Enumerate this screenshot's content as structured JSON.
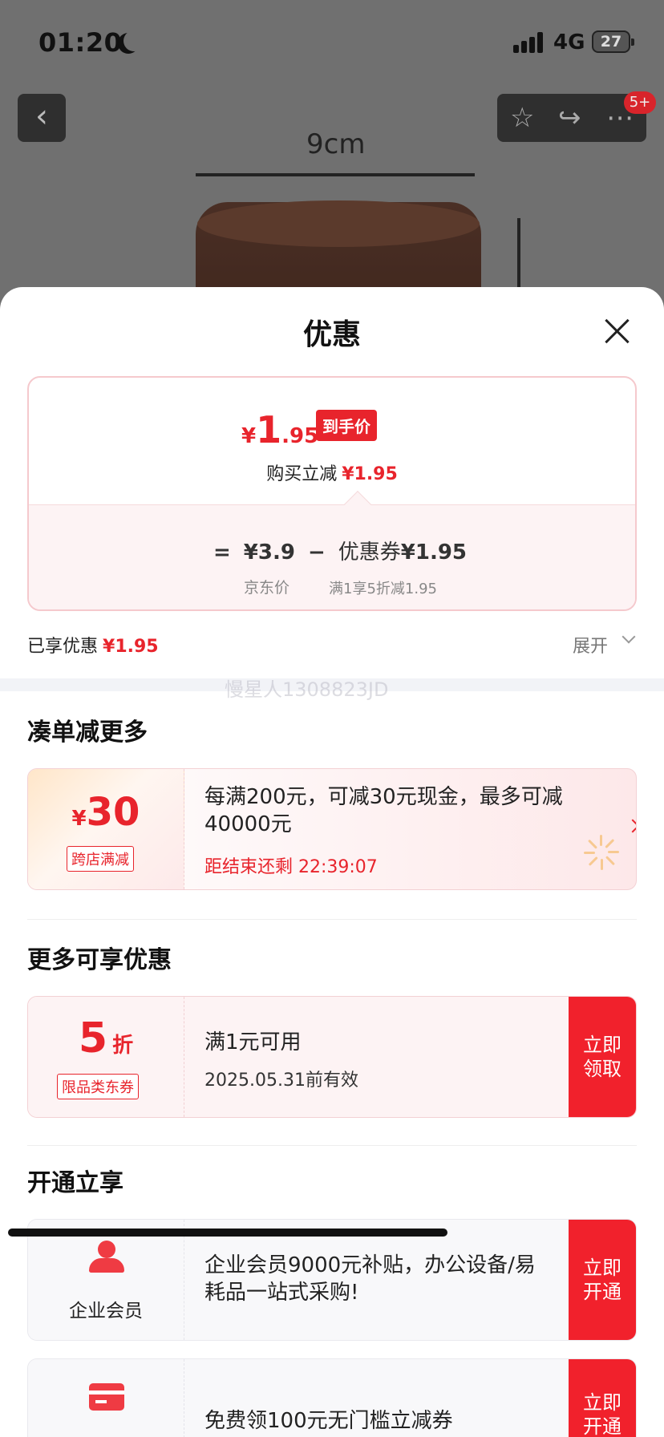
{
  "status_bar": {
    "time": "01:20",
    "network": "4G",
    "battery": "27"
  },
  "product_header": {
    "cart_badge": "5+",
    "dimension_label": "9cm"
  },
  "sheet": {
    "title": "优惠",
    "price_card": {
      "currency": "¥",
      "price_int": "1",
      "price_dec": ".95",
      "price_tag": "到手价",
      "buy_label": "购买立减",
      "buy_amount": "¥1.95",
      "equals": "=",
      "jd_price": "¥3.9",
      "minus": "−",
      "coupon_label": "优惠券",
      "coupon_amount": "¥1.95",
      "jd_price_label": "京东价",
      "coupon_rule": "满1享5折减1.95"
    },
    "enjoyed": {
      "label": "已享优惠",
      "amount": "¥1.95",
      "expand": "展开"
    },
    "watermark": "慢星人1308823JD",
    "sections": {
      "more_save": {
        "title": "凑单减更多",
        "currency": "¥",
        "amount": "30",
        "tag": "跨店满减",
        "description": "每满200元，可减30元现金，最多可减40000元",
        "timer": "距结束还剩 22:39:07"
      },
      "more_offers": {
        "title": "更多可享优惠",
        "discount": "5",
        "unit": "折",
        "tag": "限品类东券",
        "condition": "满1元可用",
        "validity": "2025.05.31前有效",
        "button": "立即领取"
      },
      "open_enjoy": {
        "title": "开通立享",
        "member_label": "企业会员",
        "member_desc": "企业会员9000元补贴，办公设备/易耗品一站式采购!",
        "member_button": "立即开通",
        "coupon_desc": "免费领100元无门槛立减券",
        "coupon_button": "立即开通"
      }
    }
  },
  "colors": {
    "accent": "#e8242c",
    "button": "#f1212c",
    "card_border": "#f5c9cd"
  }
}
